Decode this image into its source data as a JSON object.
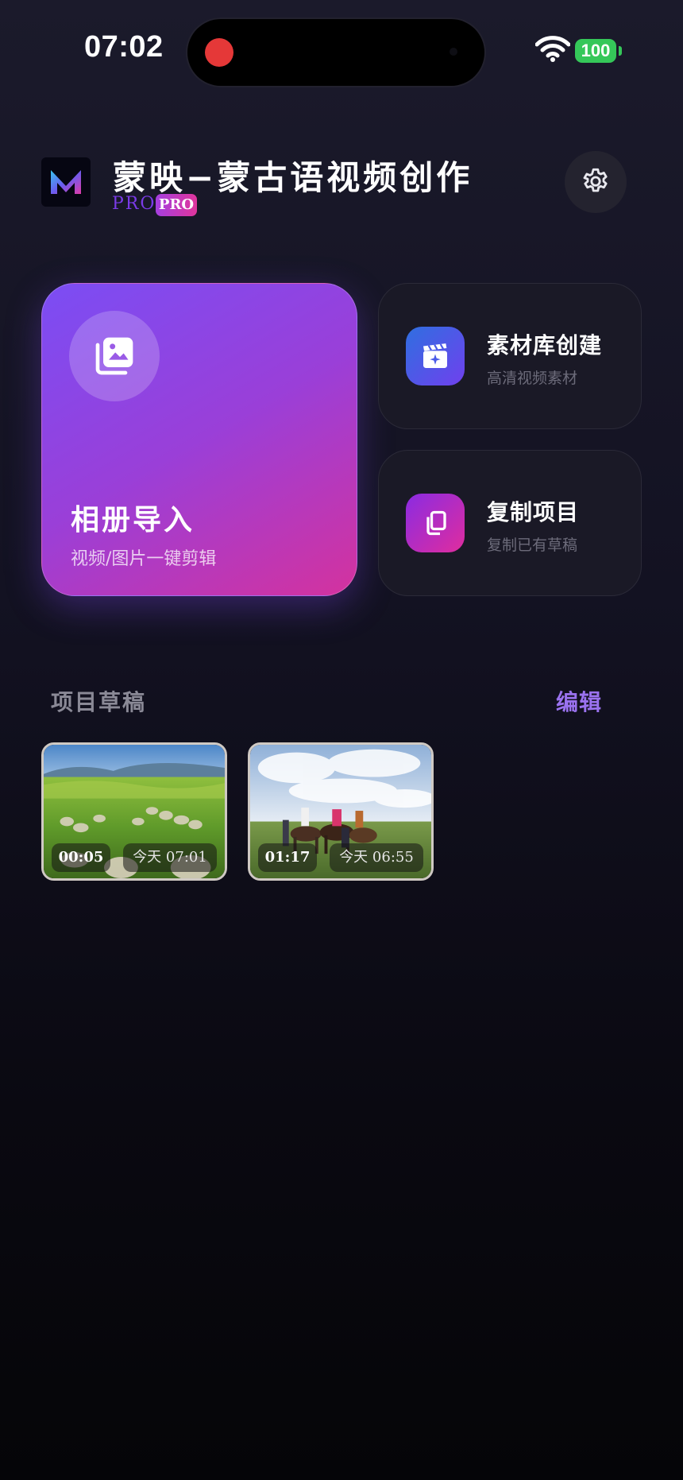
{
  "status_bar": {
    "time": "07:02",
    "battery": "100"
  },
  "header": {
    "app_title": "蒙映−蒙古语视频创作",
    "pro_text": "PRO",
    "pro_badge": "PRO"
  },
  "actions": {
    "import": {
      "title": "相册导入",
      "subtitle": "视频/图片一键剪辑"
    },
    "library": {
      "title": "素材库创建",
      "subtitle": "高清视频素材"
    },
    "copy": {
      "title": "复制项目",
      "subtitle": "复制已有草稿"
    }
  },
  "drafts": {
    "section_title": "项目草稿",
    "edit_label": "编辑",
    "items": [
      {
        "duration": "00:05",
        "date": "今天 07:01",
        "scene": "grassland-sheep"
      },
      {
        "duration": "01:17",
        "date": "今天 06:55",
        "scene": "grassland-horse-riders"
      }
    ]
  },
  "colors": {
    "accent": "#9a72ef",
    "import_gradient": [
      "#7b4df4",
      "#d4329e"
    ],
    "library_icon_gradient": [
      "#2f6fe0",
      "#7040ee"
    ],
    "copy_icon_gradient": [
      "#8a2be2",
      "#e02d9e"
    ],
    "battery": "#35c759",
    "recording": "#e53838"
  }
}
